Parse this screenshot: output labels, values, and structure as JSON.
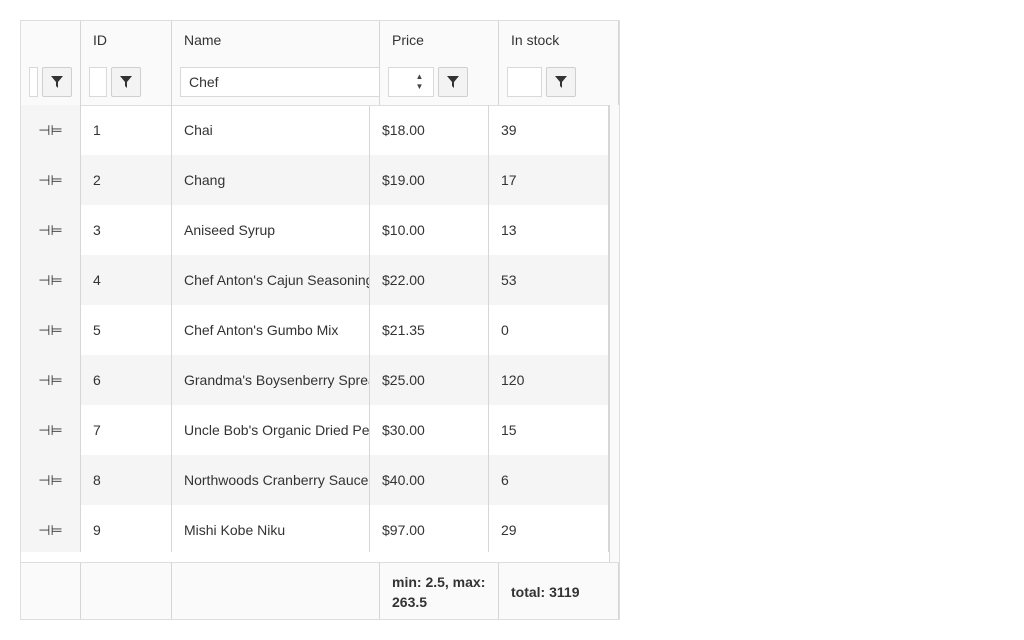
{
  "columns": {
    "id": "ID",
    "name": "Name",
    "price": "Price",
    "in_stock": "In stock"
  },
  "filters": {
    "name_value": "Chef",
    "id_value": "",
    "price_value": "",
    "stock_value": ""
  },
  "icons": {
    "filter": "filter-icon",
    "pin": "pin-icon",
    "spinner": "spinner-icon"
  },
  "rows": [
    {
      "id": "1",
      "name": "Chai",
      "price": "$18.00",
      "stock": "39"
    },
    {
      "id": "2",
      "name": "Chang",
      "price": "$19.00",
      "stock": "17"
    },
    {
      "id": "3",
      "name": "Aniseed Syrup",
      "price": "$10.00",
      "stock": "13"
    },
    {
      "id": "4",
      "name": "Chef Anton's Cajun Seasoning",
      "price": "$22.00",
      "stock": "53"
    },
    {
      "id": "5",
      "name": "Chef Anton's Gumbo Mix",
      "price": "$21.35",
      "stock": "0"
    },
    {
      "id": "6",
      "name": "Grandma's Boysenberry Spread",
      "price": "$25.00",
      "stock": "120"
    },
    {
      "id": "7",
      "name": "Uncle Bob's Organic Dried Pears",
      "price": "$30.00",
      "stock": "15"
    },
    {
      "id": "8",
      "name": "Northwoods Cranberry Sauce",
      "price": "$40.00",
      "stock": "6"
    },
    {
      "id": "9",
      "name": "Mishi Kobe Niku",
      "price": "$97.00",
      "stock": "29"
    }
  ],
  "footer": {
    "price_summary": "min: 2.5, max: 263.5",
    "stock_summary": "total: 3119"
  }
}
